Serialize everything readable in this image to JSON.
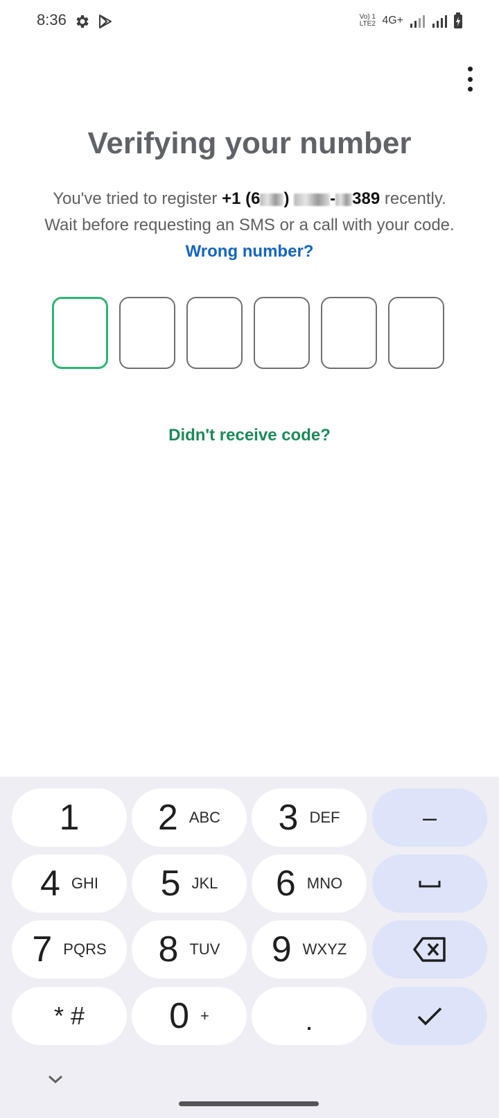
{
  "status_bar": {
    "time": "8:36",
    "volte_line1": "Vo) 1",
    "volte_line2": "LTE2",
    "network": "4G+"
  },
  "header": {
    "title": "Verifying your number"
  },
  "message": {
    "text_before": "You've tried to register ",
    "phone_prefix": "+1 (6",
    "phone_suffix": "389",
    "text_after": " recently. Wait before requesting an SMS or a call with your code. ",
    "wrong_number": "Wrong number?"
  },
  "code_input": {
    "digits": [
      "",
      "",
      "",
      "",
      "",
      ""
    ]
  },
  "resend": {
    "label": "Didn't receive code?"
  },
  "keypad": {
    "keys": [
      {
        "num": "1",
        "letters": ""
      },
      {
        "num": "2",
        "letters": "ABC"
      },
      {
        "num": "3",
        "letters": "DEF"
      },
      {
        "num": "4",
        "letters": "GHI"
      },
      {
        "num": "5",
        "letters": "JKL"
      },
      {
        "num": "6",
        "letters": "MNO"
      },
      {
        "num": "7",
        "letters": "PQRS"
      },
      {
        "num": "8",
        "letters": "TUV"
      },
      {
        "num": "9",
        "letters": "WXYZ"
      },
      {
        "num": "* #",
        "letters": ""
      },
      {
        "num": "0",
        "letters": "+"
      },
      {
        "num": ".",
        "letters": ""
      }
    ],
    "minus": "–",
    "colors": {
      "key_bg": "#ffffff",
      "fn_bg": "#dde3f8",
      "pad_bg": "#eeeef4"
    }
  },
  "colors": {
    "accent_green": "#2bb673",
    "link_blue": "#1565c0",
    "resend_green": "#1d8a5a"
  },
  "icons": [
    "gear-icon",
    "play-icon",
    "signal-icon",
    "battery-icon",
    "more-vert-icon",
    "space-icon",
    "backspace-icon",
    "check-icon",
    "chevron-down-icon"
  ]
}
